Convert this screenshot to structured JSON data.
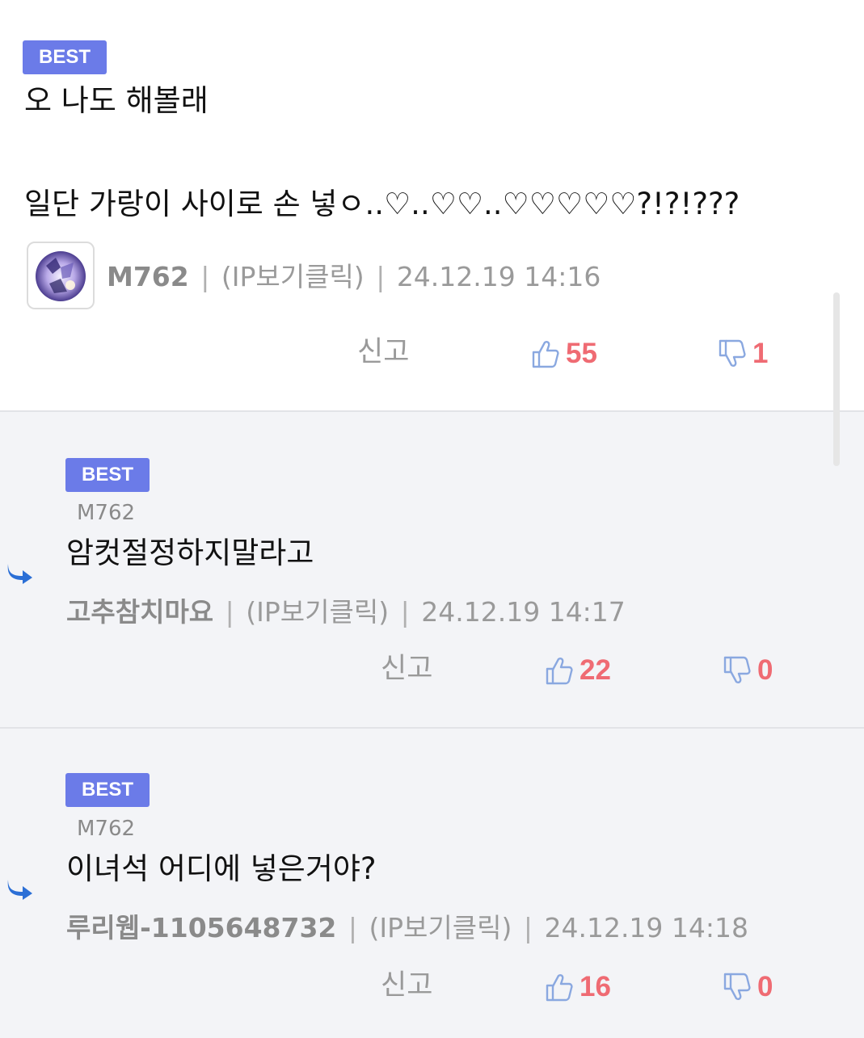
{
  "comments": [
    {
      "badge": "BEST",
      "line1": "오 나도 해볼래",
      "line2": "일단 가랑이 사이로 손 넣ㅇ..♡..♡♡..♡♡♡♡♡?!?!???",
      "author": "M762",
      "ip": "(IP보기클릭)",
      "date": "24.12.19 14:16",
      "report": "신고",
      "likes": "55",
      "dislikes": "1"
    }
  ],
  "replies": [
    {
      "badge": "BEST",
      "reply_to": "M762",
      "text": "암컷절정하지말라고",
      "author": "고추참치마요",
      "ip": "(IP보기클릭)",
      "date": "24.12.19 14:17",
      "report": "신고",
      "likes": "22",
      "dislikes": "0"
    },
    {
      "badge": "BEST",
      "reply_to": "M762",
      "text": "이녀석 어디에 넣은거야?",
      "author": "루리웹-1105648732",
      "ip": "(IP보기클릭)",
      "date": "24.12.19 14:18",
      "report": "신고",
      "likes": "16",
      "dislikes": "0"
    }
  ],
  "separator": "|",
  "colors": {
    "badge": "#6b7be8",
    "count": "#ef6b73",
    "reply_bg": "#f3f4f7",
    "reply_arrow": "#2b6fd6"
  },
  "icons": [
    "thumbs-up-icon",
    "thumbs-down-icon",
    "reply-arrow-icon",
    "avatar-image"
  ]
}
